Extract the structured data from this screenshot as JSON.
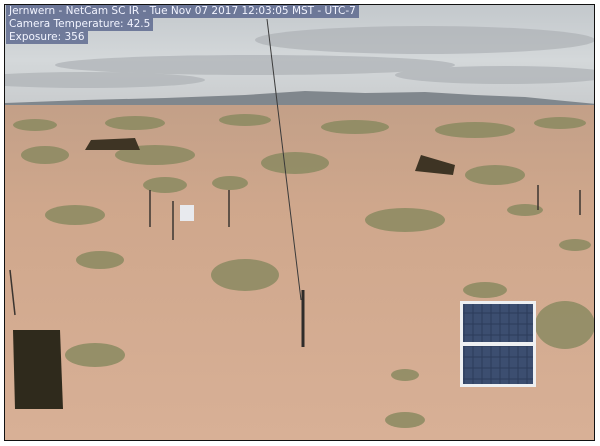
{
  "overlay": {
    "line1": "Jernwern  -  NetCam SC IR  -  Tue Nov 07 2017 12:03:05 MST - UTC-7",
    "line2": "Camera Temperature:  42.5",
    "line3": "Exposure: 356"
  },
  "scene": {
    "sky_color": "#cfd3d6",
    "cloud_color": "#aeb2b6",
    "mountain_color": "#7d848a",
    "ground_color": "#d2a88c",
    "shrub_color": "#8d8c62",
    "solar_panel_color": "#2d3f5e"
  }
}
